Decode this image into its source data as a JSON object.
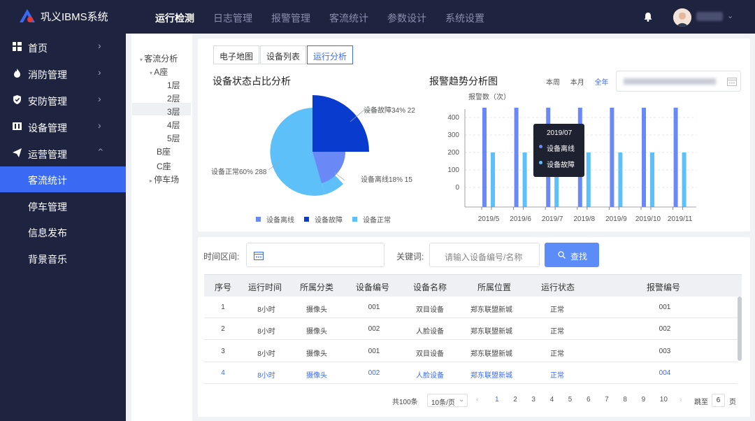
{
  "app": {
    "title": "巩义IBMS系统"
  },
  "topnav": {
    "items": [
      "运行检测",
      "日志管理",
      "报警管理",
      "客流统计",
      "参数设计",
      "系统设置"
    ],
    "active": 0
  },
  "sidebar": {
    "items": [
      {
        "label": "首页",
        "icon": "dashboard-icon"
      },
      {
        "label": "消防管理",
        "icon": "fire-icon"
      },
      {
        "label": "安防管理",
        "icon": "shield-icon"
      },
      {
        "label": "设备管理",
        "icon": "device-icon"
      },
      {
        "label": "运营管理",
        "icon": "send-icon"
      }
    ],
    "subitems": [
      "客流统计",
      "停车管理",
      "信息发布",
      "背景音乐"
    ],
    "active_sub": 0
  },
  "tree": {
    "root": "客流分析",
    "building_a": "A座",
    "floors": [
      "1层",
      "2层",
      "3层",
      "4层",
      "5层"
    ],
    "building_b": "B座",
    "building_c": "C座",
    "parking": "停车场"
  },
  "tabs": {
    "items": [
      "电子地图",
      "设备列表",
      "运行分析"
    ],
    "active": 2
  },
  "pie_card": {
    "title": "设备状态占比分析",
    "labels": {
      "fault": "设备故障34% 22",
      "offline": "设备离线18% 15",
      "normal": "设备正常60% 288"
    },
    "legend": [
      "设备离线",
      "设备故障",
      "设备正常"
    ]
  },
  "colors": {
    "offline": "#6b88f7",
    "fault": "#0a3bcf",
    "normal": "#5ec0f8",
    "accent": "#3a6af3",
    "nav_bg": "#1e2340"
  },
  "trend_card": {
    "title": "报警趋势分析图",
    "ranges": [
      "本周",
      "本月",
      "全年"
    ],
    "active_range": 2
  },
  "chart_data": {
    "type": "bar",
    "ylabel": "报警数（次）",
    "categories": [
      "2019/5",
      "2019/6",
      "2019/7",
      "2019/8",
      "2019/9",
      "2019/10",
      "2019/11"
    ],
    "yticks": [
      0,
      100,
      200,
      300,
      400
    ],
    "series": [
      {
        "name": "设备离线",
        "values": [
          460,
          460,
          460,
          460,
          460,
          460,
          460
        ]
      },
      {
        "name": "设备故障",
        "values": [
          200,
          200,
          200,
          200,
          200,
          200,
          200
        ]
      }
    ],
    "tooltip": {
      "title": "2019/07",
      "items": [
        "设备离线",
        "设备故障"
      ]
    }
  },
  "filters": {
    "time_label": "时间区间:",
    "keyword_label": "关键词:",
    "keyword_placeholder": "请输入设备编号/名称",
    "search_label": "查找"
  },
  "table": {
    "headers": [
      "序号",
      "运行时间",
      "所属分类",
      "设备编号",
      "设备名称",
      "所属位置",
      "运行状态",
      "报警编号"
    ],
    "rows": [
      [
        "1",
        "8小时",
        "摄像头",
        "001",
        "双目设备",
        "郑东联盟新城",
        "正常",
        "001"
      ],
      [
        "2",
        "8小时",
        "摄像头",
        "002",
        "人脸设备",
        "郑东联盟新城",
        "正常",
        "002"
      ],
      [
        "3",
        "8小时",
        "摄像头",
        "001",
        "双目设备",
        "郑东联盟新城",
        "正常",
        "003"
      ],
      [
        "4",
        "8小时",
        "摄像头",
        "002",
        "人脸设备",
        "郑东联盟新城",
        "正常",
        "004"
      ]
    ]
  },
  "pagination": {
    "total": "共100条",
    "per_page": "10条/页",
    "pages": [
      "1",
      "2",
      "3",
      "4",
      "5",
      "6",
      "7",
      "8",
      "9",
      "10"
    ],
    "current": "1",
    "goto_label": "跳至",
    "goto_value": "6",
    "page_unit": "页"
  }
}
